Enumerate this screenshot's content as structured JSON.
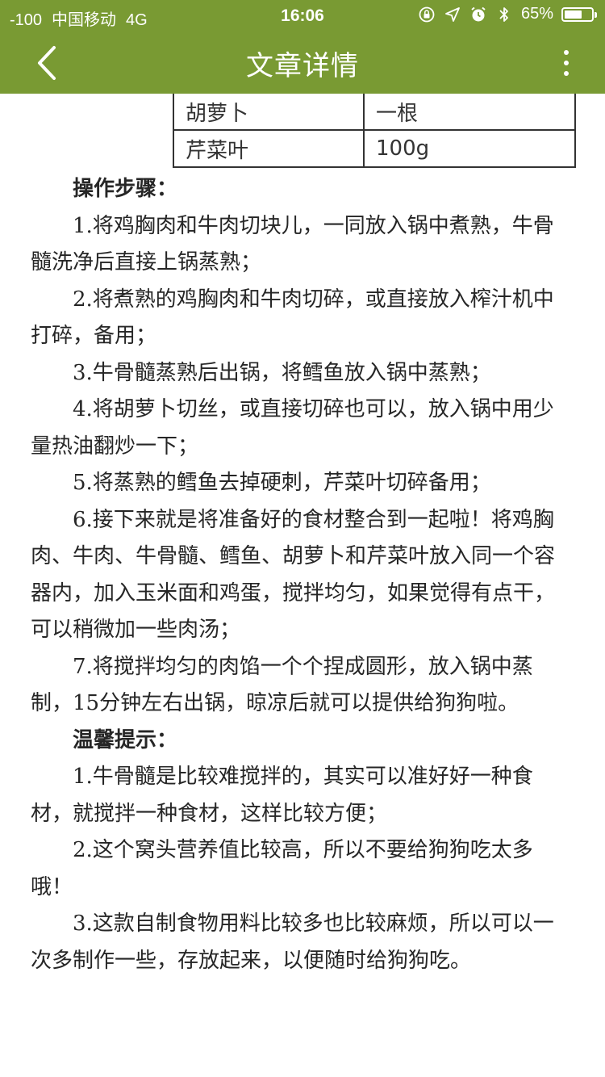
{
  "status_bar": {
    "signal": "-100",
    "carrier": "中国移动",
    "network": "4G",
    "time": "16:06",
    "battery_percent": "65%",
    "battery_level": 0.65,
    "icons": [
      "orientation-lock-icon",
      "location-icon",
      "alarm-icon",
      "bluetooth-icon",
      "battery-icon"
    ]
  },
  "navbar": {
    "title": "文章详情",
    "back_icon": "chevron-left-icon",
    "more_icon": "more-vertical-icon",
    "background": "#799a33"
  },
  "ingredients_table": {
    "rows": [
      [
        "胡萝卜",
        "一根"
      ],
      [
        "芹菜叶",
        "100g"
      ]
    ]
  },
  "article": {
    "steps_heading": "操作步骤：",
    "steps": [
      "1.将鸡胸肉和牛肉切块儿，一同放入锅中煮熟，牛骨髓洗净后直接上锅蒸熟；",
      "2.将煮熟的鸡胸肉和牛肉切碎，或直接放入榨汁机中打碎，备用；",
      "3.牛骨髓蒸熟后出锅，将鳕鱼放入锅中蒸熟；",
      "4.将胡萝卜切丝，或直接切碎也可以，放入锅中用少量热油翻炒一下；",
      "5.将蒸熟的鳕鱼去掉硬刺，芹菜叶切碎备用；",
      "6.接下来就是将准备好的食材整合到一起啦！将鸡胸肉、牛肉、牛骨髓、鳕鱼、胡萝卜和芹菜叶放入同一个容器内，加入玉米面和鸡蛋，搅拌均匀，如果觉得有点干，可以稍微加一些肉汤；",
      "7.将搅拌均匀的肉馅一个个捏成圆形，放入锅中蒸制，15分钟左右出锅，晾凉后就可以提供给狗狗啦。"
    ],
    "tips_heading": "温馨提示：",
    "tips": [
      "1.牛骨髓是比较难搅拌的，其实可以准好好一种食材，就搅拌一种食材，这样比较方便；",
      "2.这个窝头营养值比较高，所以不要给狗狗吃太多哦！",
      "3.这款自制食物用料比较多也比较麻烦，所以可以一次多制作一些，存放起来，以便随时给狗狗吃。"
    ]
  }
}
